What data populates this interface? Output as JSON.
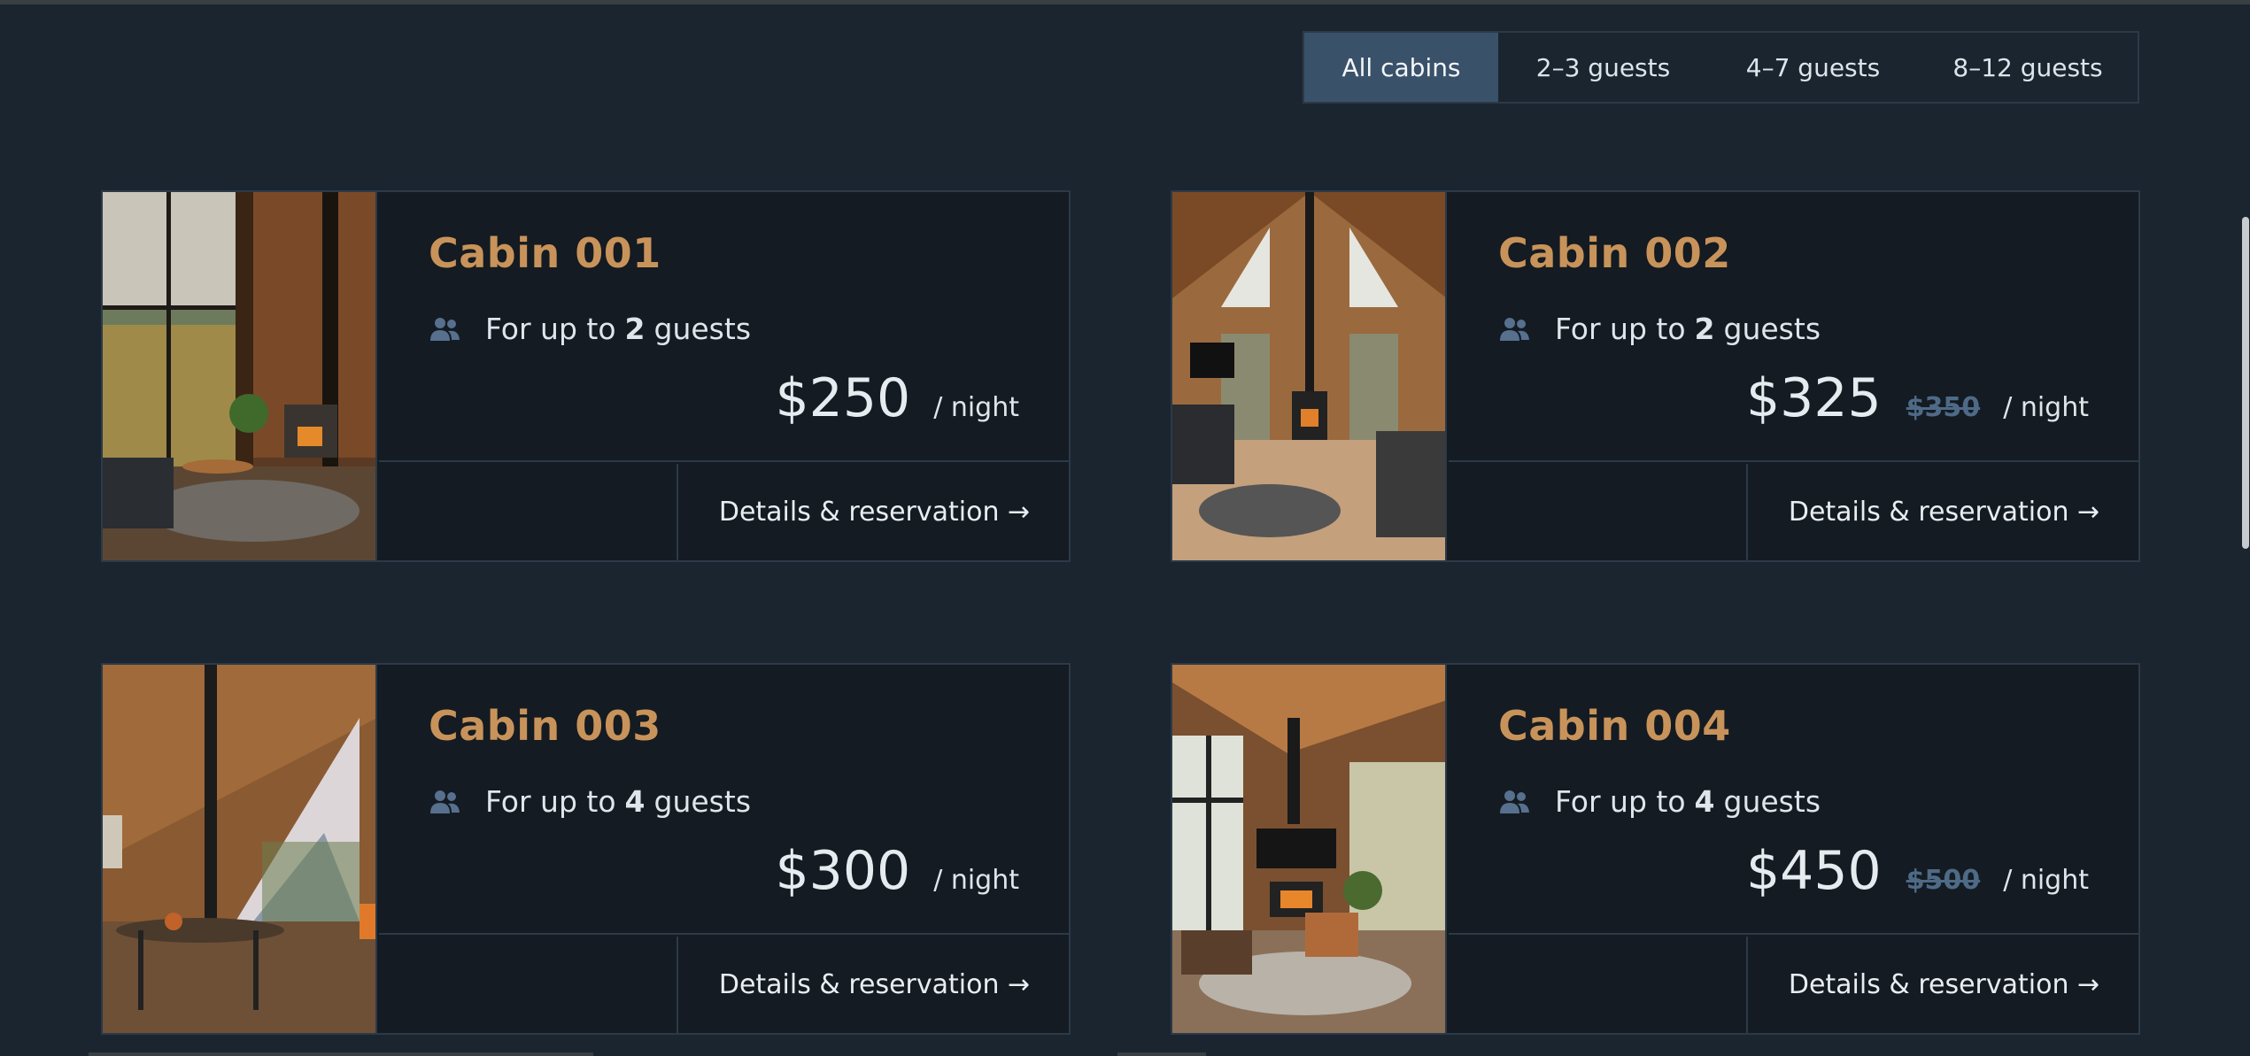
{
  "filters": [
    {
      "label": "All cabins",
      "active": true
    },
    {
      "label": "2–3 guests",
      "active": false
    },
    {
      "label": "4–7 guests",
      "active": false
    },
    {
      "label": "8–12 guests",
      "active": false
    }
  ],
  "guests_prefix": "For up to",
  "guests_suffix": "guests",
  "per_night": "/ night",
  "action_label": "Details & reservation →",
  "icon": "users-icon",
  "colors": {
    "title": "#c8935a",
    "active_filter": "#3a516a",
    "old_price": "#4e6a86",
    "background": "#1b2530",
    "card": "#141b22"
  },
  "cabins": [
    {
      "name": "Cabin 001",
      "guests": "2",
      "price": "$250",
      "old_price": ""
    },
    {
      "name": "Cabin 002",
      "guests": "2",
      "price": "$325",
      "old_price": "$350"
    },
    {
      "name": "Cabin 003",
      "guests": "4",
      "price": "$300",
      "old_price": ""
    },
    {
      "name": "Cabin 004",
      "guests": "4",
      "price": "$450",
      "old_price": "$500"
    }
  ]
}
